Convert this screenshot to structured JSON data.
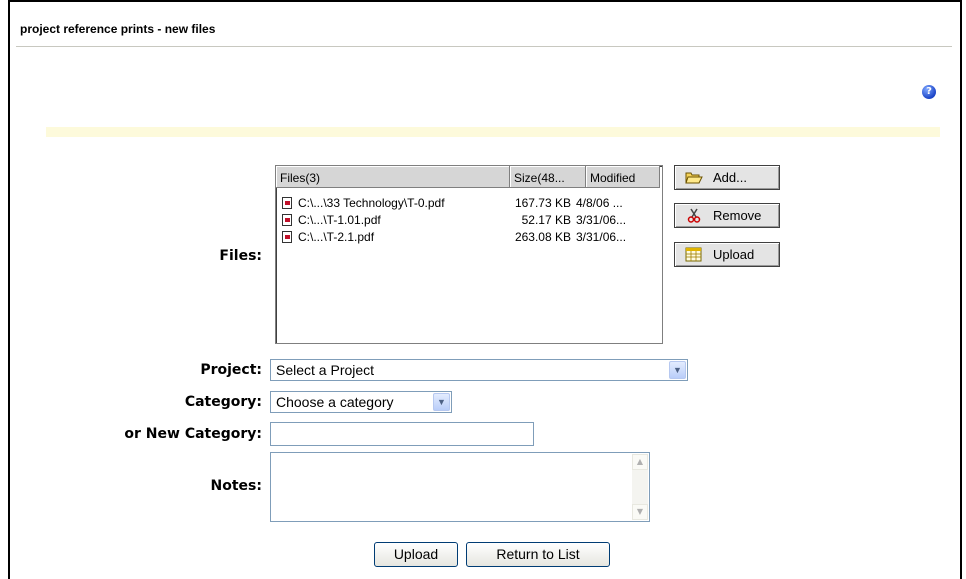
{
  "page": {
    "title": "project reference prints - new files",
    "help_icon": "help-icon"
  },
  "files": {
    "label": "Files:",
    "columns": {
      "name": "Files(3)",
      "size": "Size(48...",
      "modified": "Modified"
    },
    "rows": [
      {
        "name": "C:\\...\\33 Technology\\T-0.pdf",
        "size": "167.73 KB",
        "modified": "4/8/06 ..."
      },
      {
        "name": "C:\\...\\T-1.01.pdf",
        "size": "52.17 KB",
        "modified": "3/31/06..."
      },
      {
        "name": "C:\\...\\T-2.1.pdf",
        "size": "263.08 KB",
        "modified": "3/31/06..."
      }
    ],
    "buttons": {
      "add": "Add...",
      "remove": "Remove",
      "upload": "Upload"
    }
  },
  "form": {
    "project": {
      "label": "Project:",
      "value": "Select a Project"
    },
    "category": {
      "label": "Category:",
      "value": "Choose a category"
    },
    "new_category": {
      "label": "or New Category:",
      "value": ""
    },
    "notes": {
      "label": "Notes:",
      "value": ""
    }
  },
  "actions": {
    "upload": "Upload",
    "return": "Return to List"
  }
}
